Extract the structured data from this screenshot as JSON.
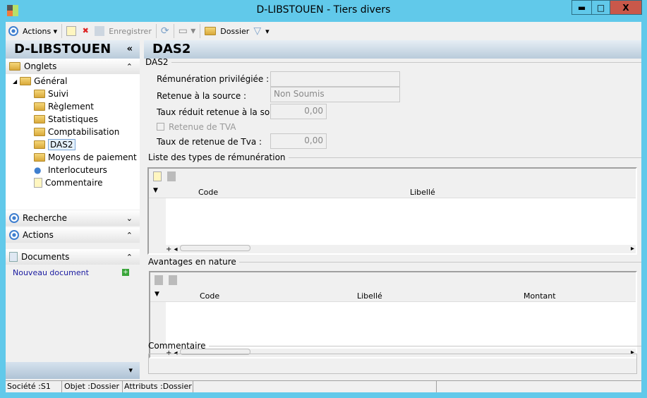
{
  "window": {
    "title": "D-LIBSTOUEN -  Tiers divers",
    "minimize": "▬",
    "maximize": "□",
    "close": "X"
  },
  "toolbar": {
    "actions": "Actions",
    "save": "Enregistrer",
    "dossier": "Dossier"
  },
  "left": {
    "title": "D-LIBSTOUEN",
    "collapse": "«",
    "onglets": "Onglets",
    "tree": [
      "Général",
      "Suivi",
      "Règlement",
      "Statistiques",
      "Comptabilisation",
      "DAS2",
      "Moyens de paiement",
      "Interlocuteurs",
      "Commentaire"
    ],
    "recherche": "Recherche",
    "actions": "Actions",
    "documents": "Documents",
    "new_doc": "Nouveau document"
  },
  "main": {
    "title": "DAS2",
    "group": "DAS2",
    "fields": [
      {
        "label": "Rémunération privilégiée :",
        "value": ""
      },
      {
        "label": "Retenue à la source :",
        "value": "Non Soumis"
      },
      {
        "label": "Taux réduit retenue à la source :",
        "value": "0,00"
      },
      {
        "label": "Taux de retenue de Tva :",
        "value": "0,00"
      }
    ],
    "checkbox": "Retenue de TVA",
    "list1": {
      "title": "Liste des types de rémunération",
      "cols": [
        "Code",
        "Libellé"
      ]
    },
    "list2": {
      "title": "Avantages en nature",
      "cols": [
        "Code",
        "Libellé",
        "Montant"
      ]
    },
    "comment": "Commentaire"
  },
  "status": [
    "Société :S1",
    "Objet :Dossier",
    "Attributs :Dossier"
  ]
}
